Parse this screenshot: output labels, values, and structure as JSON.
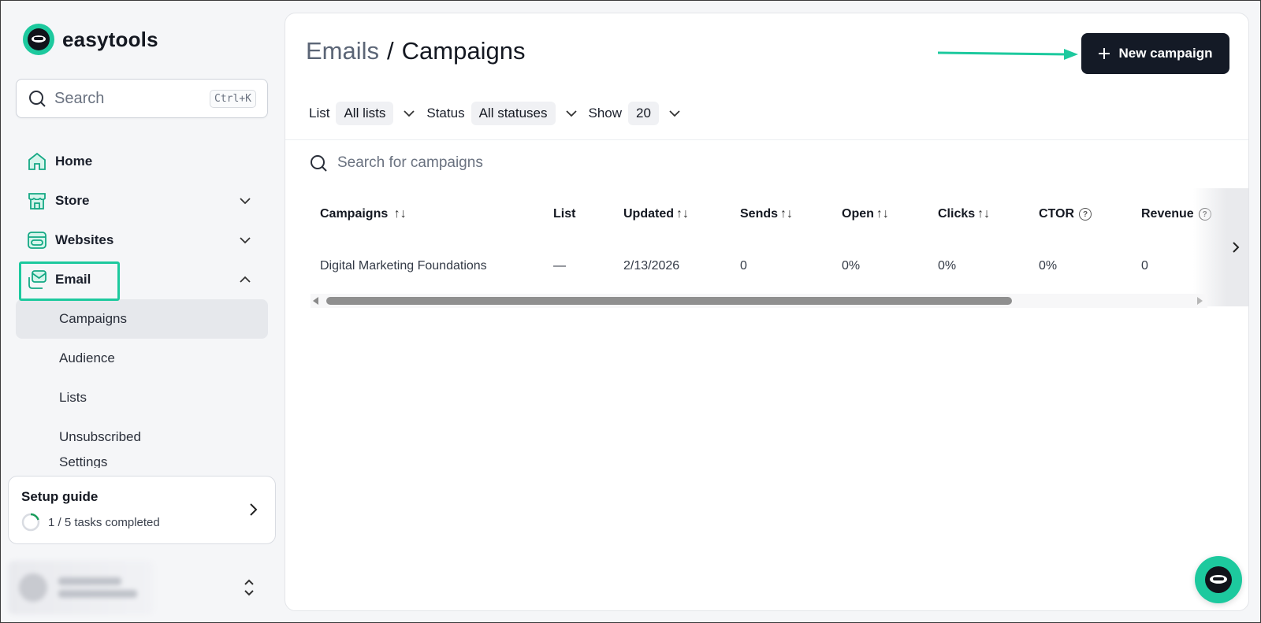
{
  "brand": {
    "name": "easytools"
  },
  "sidebar": {
    "search": {
      "label": "Search",
      "shortcut": "Ctrl+K"
    },
    "items": [
      {
        "label": "Home",
        "icon": "home-icon"
      },
      {
        "label": "Store",
        "icon": "store-icon"
      },
      {
        "label": "Websites",
        "icon": "websites-icon"
      },
      {
        "label": "Email",
        "icon": "email-icon"
      }
    ],
    "email_sub": [
      "Campaigns",
      "Audience",
      "Lists",
      "Unsubscribed",
      "Settings"
    ],
    "setup_guide": {
      "title": "Setup guide",
      "progress_text": "1 / 5 tasks completed",
      "completed": 1,
      "total": 5
    }
  },
  "header": {
    "breadcrumb_parent": "Emails",
    "breadcrumb_sep": "/",
    "breadcrumb_current": "Campaigns",
    "new_button": "New campaign"
  },
  "filters": {
    "list_label": "List",
    "list_value": "All lists",
    "status_label": "Status",
    "status_value": "All statuses",
    "show_label": "Show",
    "show_value": "20"
  },
  "table": {
    "search_placeholder": "Search for campaigns",
    "columns": [
      "Campaigns",
      "List",
      "Updated",
      "Sends",
      "Open",
      "Clicks",
      "CTOR",
      "Revenue"
    ],
    "rows": [
      {
        "campaign": "Digital Marketing Foundations",
        "list": "—",
        "updated": "2/13/2026",
        "sends": "0",
        "open": "0%",
        "clicks": "0%",
        "ctor": "0%",
        "revenue": "0"
      }
    ]
  },
  "colors": {
    "accent": "#1dc99e",
    "primary_button": "#141a26"
  }
}
